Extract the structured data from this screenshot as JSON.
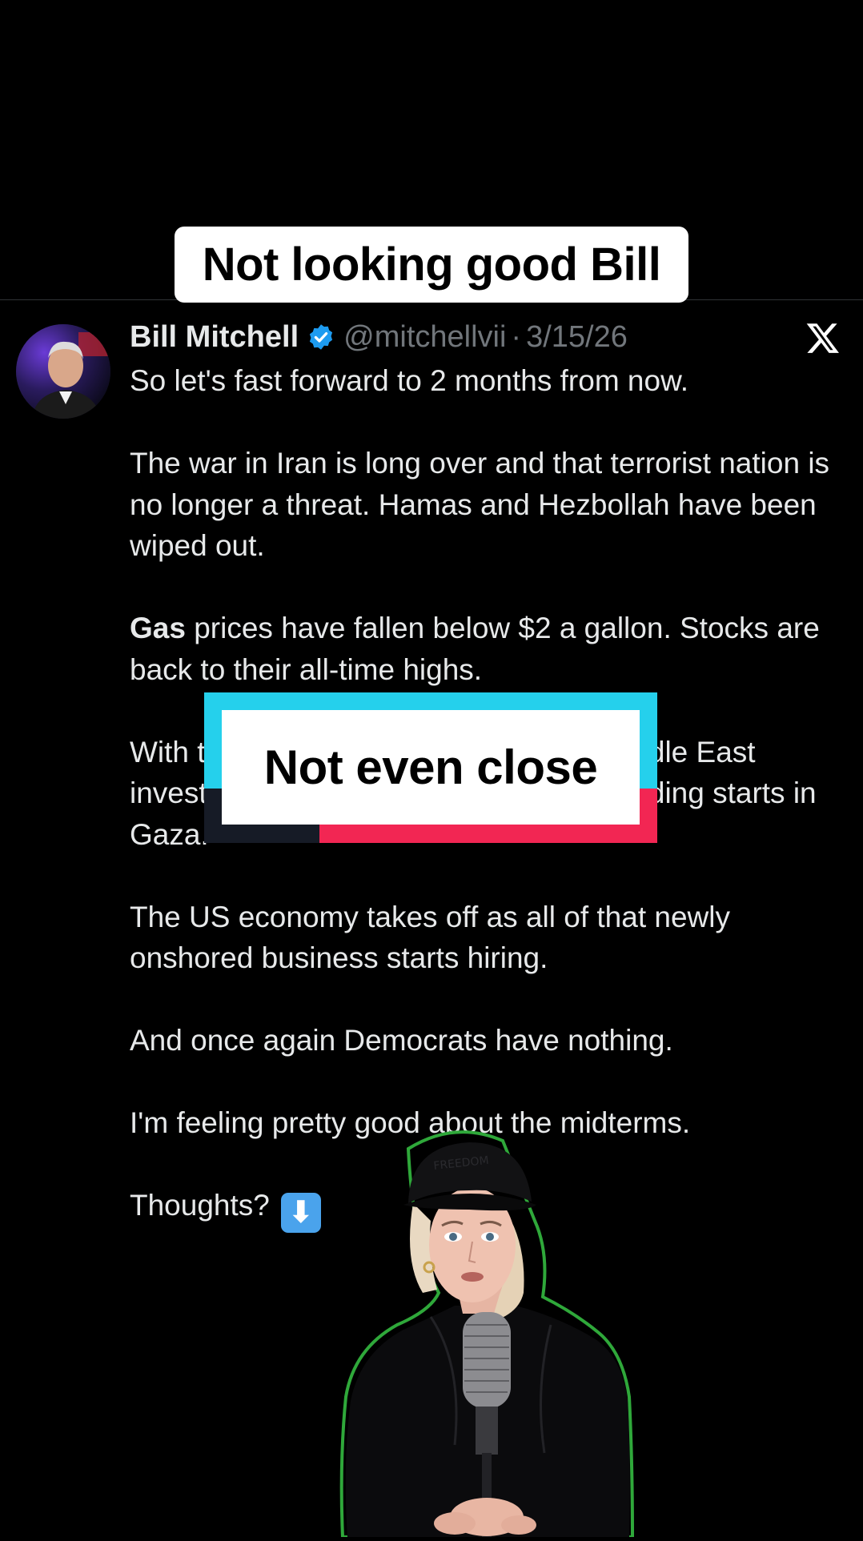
{
  "top_caption": "Not looking good Bill",
  "tweet": {
    "author_name": "Bill Mitchell",
    "handle": "@mitchellvii",
    "separator": "·",
    "date": "3/15/26",
    "paragraphs": [
      "So let's fast forward to 2 months from now.",
      "The war in Iran is long over and that terrorist nation is no longer a threat. Hamas and Hezbollah have been wiped out.",
      "prices have fallen below $2 a gallon. Stocks are back to their all-time highs.",
      "With the threats to the region gone, Middle East investment pours into the US and rebuilding starts in Gaza.",
      "The US economy takes off as all of that newly onshored business starts hiring.",
      "And once again Democrats have nothing.",
      "I'm feeling pretty good about the midterms.",
      "Thoughts?"
    ],
    "gas_bold": "Gas",
    "emoji": "⬇"
  },
  "center_caption": "Not even close",
  "icons": {
    "verified": "verified-badge-icon",
    "platform": "x-logo-icon",
    "down_arrow": "down-arrow-emoji-icon"
  },
  "colors": {
    "background": "#000000",
    "verified_blue": "#1d9bf0",
    "handle_gray": "#71767b",
    "caption_cyan": "#25d0ec",
    "caption_red": "#f22653"
  }
}
